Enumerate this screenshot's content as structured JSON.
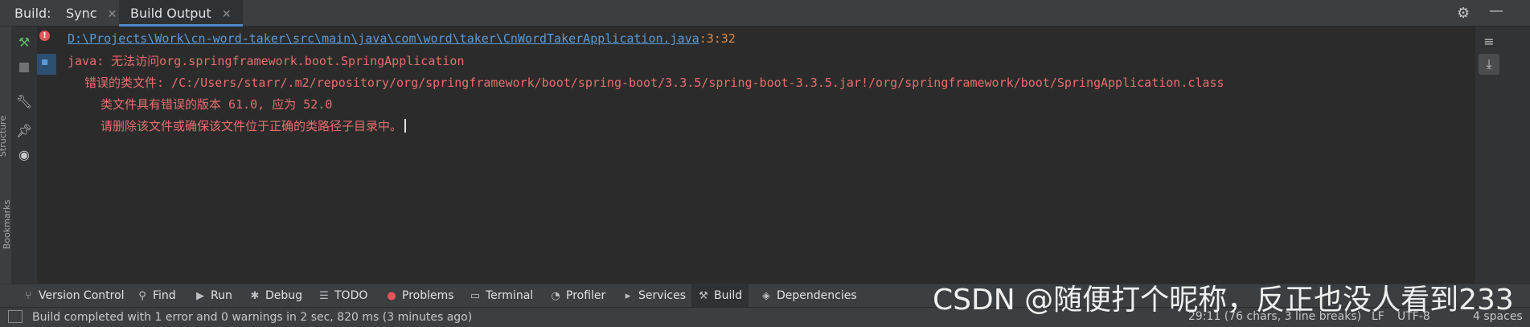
{
  "header": {
    "title": "Build:",
    "tabs": [
      {
        "label": "Sync",
        "close": "✕"
      },
      {
        "label": "Build Output",
        "close": "✕"
      }
    ]
  },
  "left_strip": {
    "labels": [
      "Structure",
      "Bookmarks"
    ]
  },
  "tree": {
    "error_icon": "error-icon",
    "item_icon": "java-file-icon"
  },
  "console": {
    "link": "D:\\Projects\\Work\\cn-word-taker\\src\\main\\java\\com\\word\\taker\\CnWordTakerApplication.java",
    "location": ":3:32",
    "lines": [
      "java: 无法访问org.springframework.boot.SpringApplication",
      "错误的类文件: /C:/Users/starr/.m2/repository/org/springframework/boot/spring-boot/3.3.5/spring-boot-3.3.5.jar!/org/springframework/boot/SpringApplication.class",
      "类文件具有错误的版本 61.0, 应为 52.0",
      "请删除该文件或确保该文件位于正确的类路径子目录中。"
    ]
  },
  "tool_windows": [
    {
      "label": "Version Control",
      "icon": "branch-icon"
    },
    {
      "label": "Find",
      "icon": "search-icon"
    },
    {
      "label": "Run",
      "icon": "play-icon"
    },
    {
      "label": "Debug",
      "icon": "bug-icon"
    },
    {
      "label": "TODO",
      "icon": "list-icon"
    },
    {
      "label": "Problems",
      "icon": "error-icon"
    },
    {
      "label": "Terminal",
      "icon": "terminal-icon"
    },
    {
      "label": "Profiler",
      "icon": "profiler-icon"
    },
    {
      "label": "Services",
      "icon": "services-icon"
    },
    {
      "label": "Build",
      "icon": "hammer-icon"
    },
    {
      "label": "Dependencies",
      "icon": "layers-icon"
    }
  ],
  "status": {
    "message": "Build completed with 1 error and 0 warnings in 2 sec, 820 ms (3 minutes ago)",
    "position": "29:11 (76 chars, 3 line breaks)",
    "line_sep": "LF",
    "encoding": "UTF-8",
    "indent": "4 spaces"
  },
  "watermark": "CSDN @随便打个昵称，反正也没人看到233",
  "colors": {
    "error": "#e86d6d",
    "link": "#5b9ad6",
    "accent": "#4a88c7"
  }
}
